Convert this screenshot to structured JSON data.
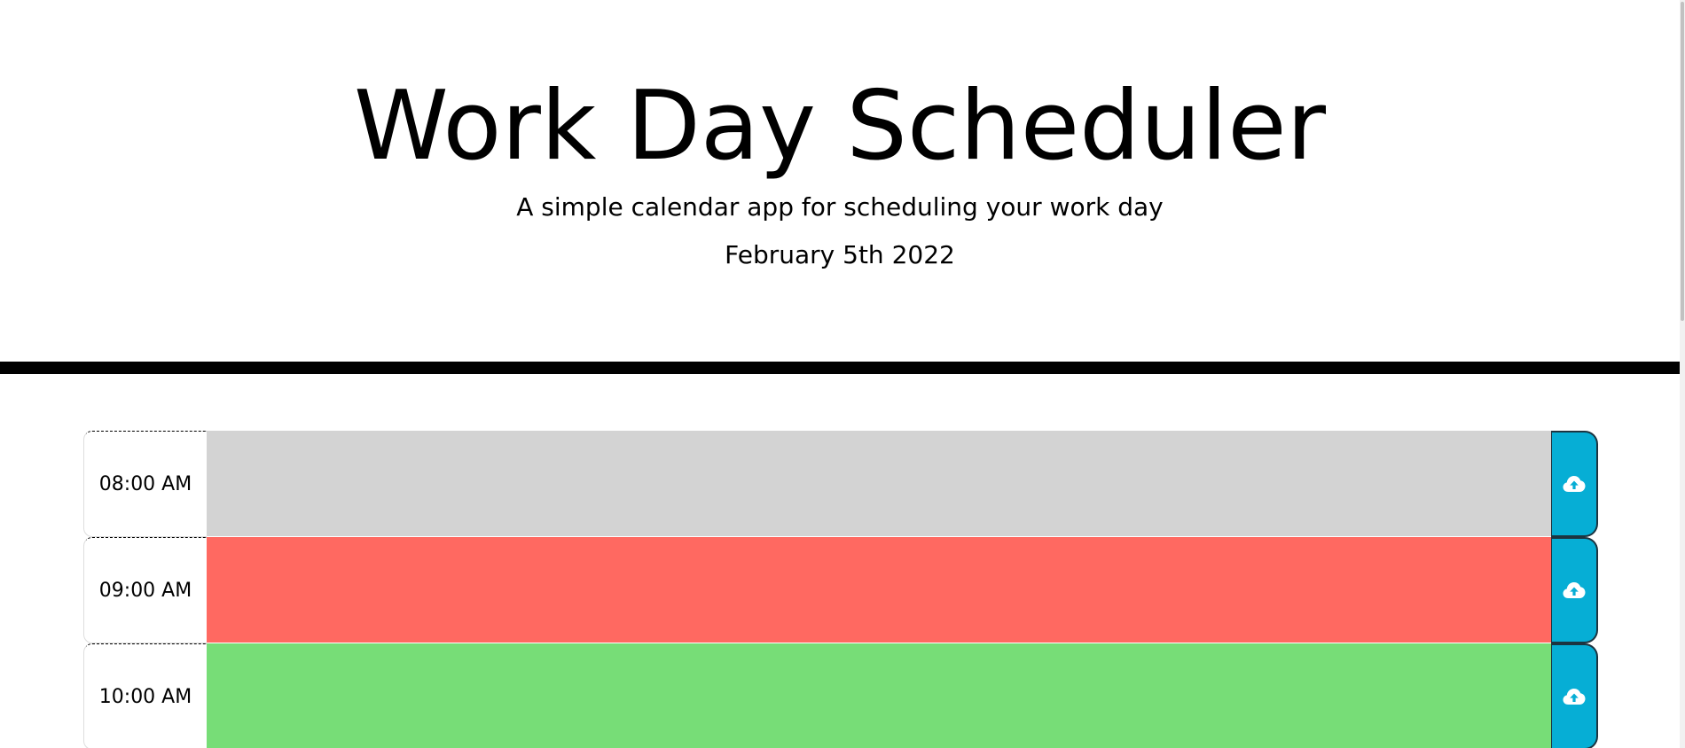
{
  "header": {
    "title": "Work Day Scheduler",
    "subtitle": "A simple calendar app for scheduling your work day",
    "current_day": "February 5th 2022"
  },
  "time_blocks": [
    {
      "hour": "08:00 AM",
      "description": "",
      "state": "past",
      "color": "#d3d3d3",
      "save_icon": "cloud-upload-icon"
    },
    {
      "hour": "09:00 AM",
      "description": "",
      "state": "present",
      "color": "#ff6961",
      "save_icon": "cloud-upload-icon"
    },
    {
      "hour": "10:00 AM",
      "description": "",
      "state": "future",
      "color": "#77dd77",
      "save_icon": "cloud-upload-icon"
    }
  ],
  "colors": {
    "save_button": "#06aed5",
    "divider": "#000000"
  }
}
